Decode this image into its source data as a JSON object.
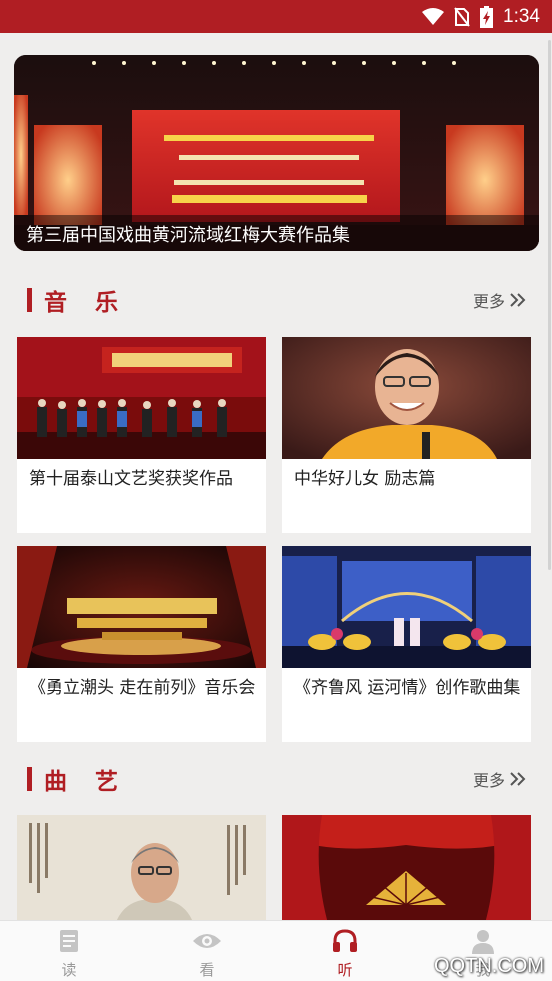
{
  "status_bar": {
    "time": "1:34"
  },
  "banner": {
    "caption": "第三届中国戏曲黄河流域红梅大赛作品集"
  },
  "sections": [
    {
      "title": "音 乐",
      "more": "更多",
      "cards": [
        {
          "title": "第十届泰山文艺奖获奖作品"
        },
        {
          "title": "中华好儿女 励志篇"
        },
        {
          "title": "《勇立潮头 走在前列》音乐会"
        },
        {
          "title": "《齐鲁风 运河情》创作歌曲集"
        }
      ]
    },
    {
      "title": "曲 艺",
      "more": "更多",
      "cards": []
    }
  ],
  "bottom_nav": [
    {
      "label": "读",
      "icon": "book-icon"
    },
    {
      "label": "看",
      "icon": "eye-icon"
    },
    {
      "label": "听",
      "icon": "headphones-icon",
      "active": true
    },
    {
      "label": "我",
      "icon": "person-icon"
    }
  ],
  "watermark": "QQTN.COM",
  "colors": {
    "accent": "#b01e23",
    "background": "#efeeed"
  }
}
